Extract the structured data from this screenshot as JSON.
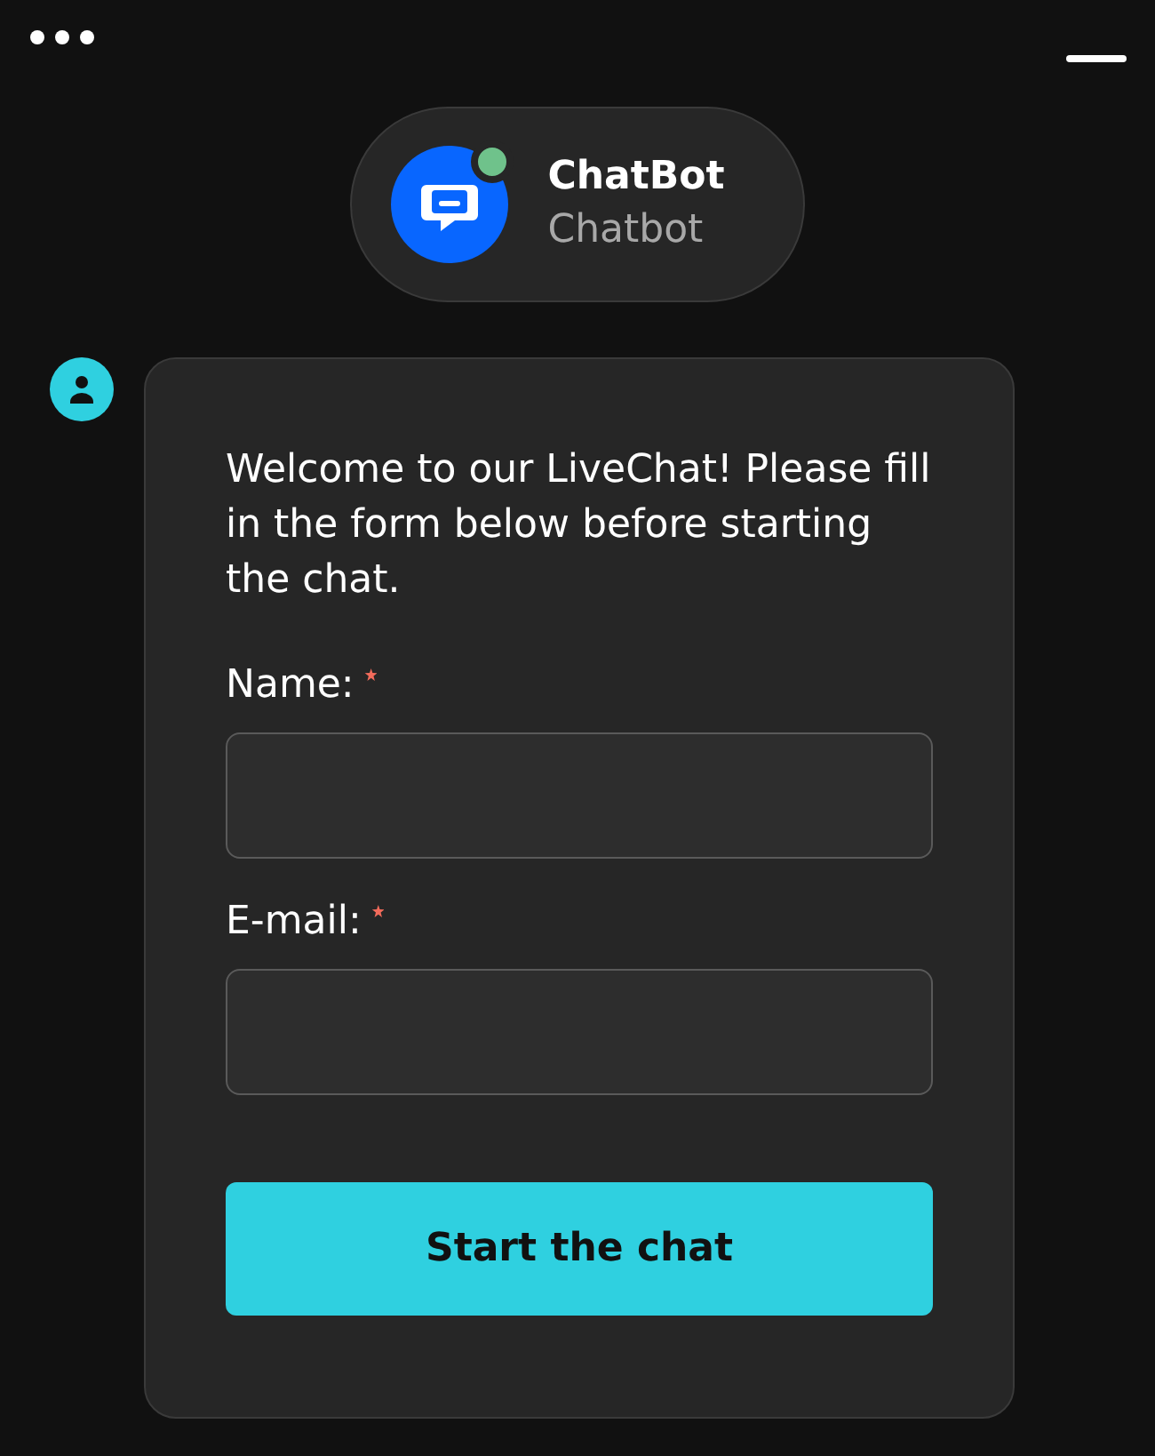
{
  "agent": {
    "name": "ChatBot",
    "role": "Chatbot",
    "online": true
  },
  "message": "Welcome to our LiveChat! Please fill in the form below before starting the chat.",
  "fields": [
    {
      "label": "Name:",
      "required": true
    },
    {
      "label": "E-mail:",
      "required": true
    }
  ],
  "button": "Start the chat"
}
